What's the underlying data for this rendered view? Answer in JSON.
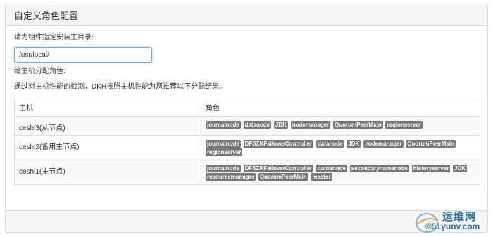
{
  "panel": {
    "title": "自定义角色配置"
  },
  "install": {
    "prompt": "请为组件指定安装主目录:",
    "value": "/usr/local/"
  },
  "assign": {
    "title": "给主机分配角色:",
    "description": "通过对主机性能的检测，DKH按照主机性能为您推荐以下分配结果。"
  },
  "table": {
    "headers": [
      "主机",
      "角色"
    ],
    "rows": [
      {
        "host": "ceshi3(从节点)",
        "roles": [
          "journalnode",
          "datanode",
          "JDK",
          "nodemanager",
          "QuorumPeerMain",
          "regionserver"
        ]
      },
      {
        "host": "ceshi2(备用主节点)",
        "roles": [
          "journalnode",
          "DFSZKFailoverController",
          "datanode",
          "JDK",
          "nodemanager",
          "QuorumPeerMain",
          "regionserver"
        ]
      },
      {
        "host": "ceshi1(主节点)",
        "roles": [
          "journalnode",
          "DFSZKFailoverController",
          "namenode",
          "secondarynamenode",
          "historyserver",
          "JDK",
          "resourcemanager",
          "QuorumPeerMain",
          "master"
        ]
      }
    ]
  },
  "watermark": {
    "cn": "运维网",
    "en": "©51yunv.com"
  },
  "colors": {
    "badge": "#777777",
    "focus": "#66afe9",
    "panel_bg": "#f5f5f5"
  }
}
